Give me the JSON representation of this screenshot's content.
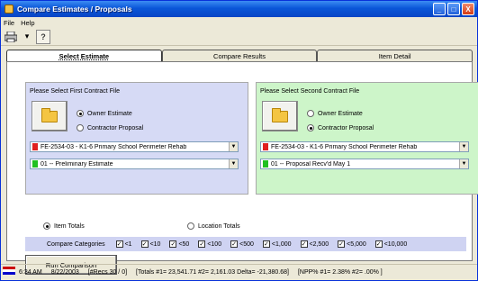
{
  "window": {
    "title": "Compare Estimates / Proposals",
    "minimize": "_",
    "maximize": "□",
    "close": "X"
  },
  "menu": [
    "File",
    "Help"
  ],
  "toolbar": {
    "help_glyph": "?"
  },
  "tabs": [
    {
      "label": "Select Estimate",
      "active": true
    },
    {
      "label": "Compare Results",
      "active": false
    },
    {
      "label": "Item Detail",
      "active": false
    }
  ],
  "first": {
    "header": "Please Select First Contract File",
    "options": [
      {
        "label": "Owner Estimate",
        "checked": true
      },
      {
        "label": "Contractor Proposal",
        "checked": false
      }
    ],
    "contract": "FE-2534-03     - K1-6 Primary School Perimeter Rehab",
    "estimate": "01 -- Preliminary Estimate",
    "contract_color": "#e02020",
    "estimate_color": "#20c020"
  },
  "second": {
    "header": "Please Select Second Contract File",
    "options": [
      {
        "label": "Owner Estimate",
        "checked": false
      },
      {
        "label": "Contractor Proposal",
        "checked": true
      }
    ],
    "contract": "FE-2534-03     - K1-6 Primary School Perimeter Rehab",
    "estimate": "01 -- Proposal Recv'd May 1",
    "contract_color": "#e02020",
    "estimate_color": "#20c020"
  },
  "totals": [
    {
      "label": "Item Totals",
      "checked": true
    },
    {
      "label": "Location Totals",
      "checked": false
    }
  ],
  "compare": {
    "label": "Compare Categories",
    "categories": [
      "<1",
      "<10",
      "<50",
      "<100",
      "<500",
      "<1,000",
      "<2,500",
      "<5,000",
      "<10,000"
    ]
  },
  "run_label": "Run Comparison",
  "status": {
    "time": "6:34 AM",
    "date": "8/22/2003",
    "recs": "[#Recs 30 / 0]",
    "totals": "[Totals #1= 23,541.71  #2= 2,161.03  Delta= -21,380.68]",
    "npp": "[NPP% #1= 2.38%  #2= .00% ]"
  }
}
